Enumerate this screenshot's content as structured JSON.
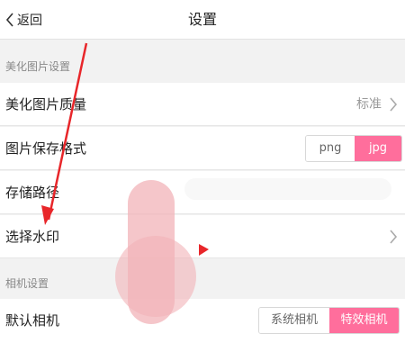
{
  "header": {
    "back_label": "返回",
    "title": "设置"
  },
  "sections": {
    "beautify": "美化图片设置",
    "camera": "相机设置"
  },
  "rows": {
    "quality": {
      "label": "美化图片质量",
      "value": "标准"
    },
    "format": {
      "label": "图片保存格式",
      "options": [
        "png",
        "jpg"
      ],
      "selected": "jpg"
    },
    "path": {
      "label": "存储路径"
    },
    "watermark": {
      "label": "选择水印"
    },
    "default_camera": {
      "label": "默认相机",
      "options": [
        "系统相机",
        "特效相机"
      ],
      "selected": "特效相机"
    }
  },
  "colors": {
    "accent": "#ff6e9c",
    "annotation_arrow": "#e8262a",
    "redaction": "#f2b3b8"
  },
  "icons": {
    "back": "chevron-left-icon",
    "row_arrow": "chevron-right-icon"
  }
}
